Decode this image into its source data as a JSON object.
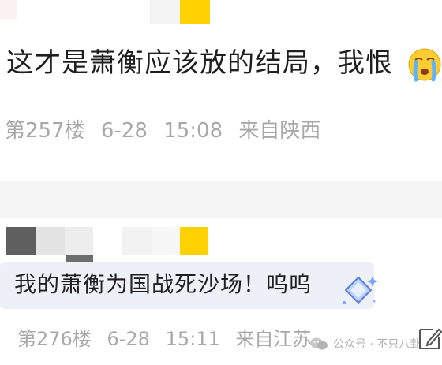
{
  "comments": [
    {
      "text": "这才是萧衡应该放的结局，我恨",
      "floor": "第257楼",
      "date": "6-28",
      "time": "15:08",
      "location": "来自陕西"
    },
    {
      "text": "我的萧衡为国战死沙场！呜呜",
      "floor": "第276楼",
      "date": "6-28",
      "time": "15:11",
      "location": "来自江苏"
    }
  ],
  "watermark": "公众号 · 不只八卦",
  "colors": {
    "bubble": "#eef0f8",
    "meta_text": "#a8a8a8",
    "avatar_yellow": "#ffd100"
  },
  "icons": [
    "crying-emoji-icon",
    "diamond-badge-icon",
    "wechat-icon",
    "edit-icon"
  ]
}
